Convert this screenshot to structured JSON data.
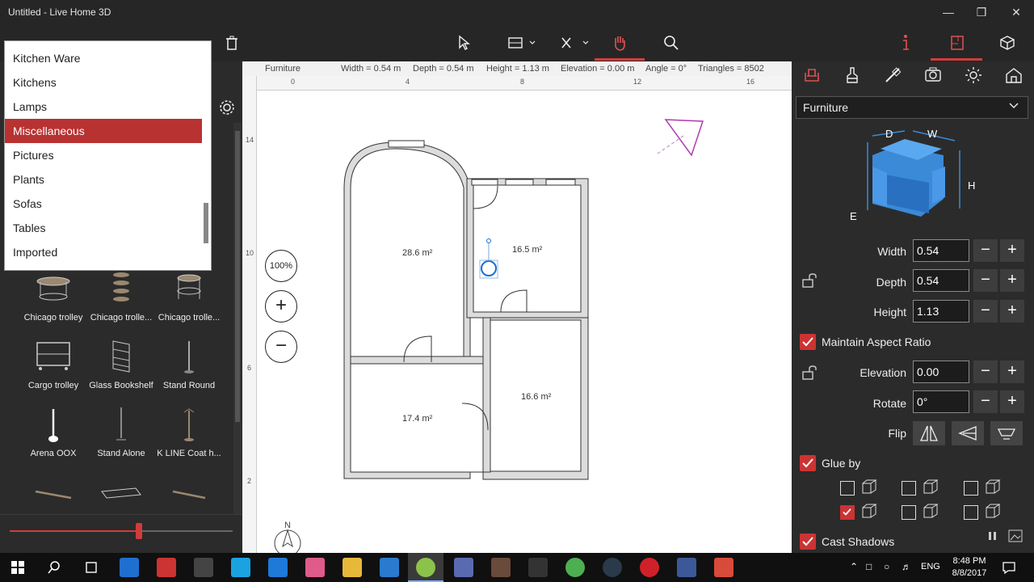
{
  "window": {
    "title": "Untitled - Live Home 3D"
  },
  "dropdown": {
    "items": [
      "Kitchen Ware",
      "Kitchens",
      "Lamps",
      "Miscellaneous",
      "Pictures",
      "Plants",
      "Sofas",
      "Tables",
      "Imported"
    ],
    "selected": "Miscellaneous"
  },
  "library": {
    "items": [
      "Chicago trolley",
      "Chicago trolle...",
      "Chicago trolle...",
      "Cargo trolley",
      "Glass Bookshelf",
      "Stand Round",
      "Arena OOX",
      "Stand Alone",
      "K LINE Coat h..."
    ]
  },
  "infobar": {
    "type": "Furniture",
    "width": "Width = 0.54 m",
    "depth": "Depth = 0.54 m",
    "height": "Height = 1.13 m",
    "elevation": "Elevation = 0.00 m",
    "angle": "Angle = 0°",
    "triangles": "Triangles = 8502"
  },
  "ruler": {
    "unit": "m",
    "h_ticks": [
      "0",
      "4",
      "8",
      "12",
      "16"
    ],
    "v_ticks": [
      "14",
      "10",
      "6",
      "2"
    ]
  },
  "plan": {
    "rooms": [
      "28.6 m²",
      "16.5 m²",
      "17.4 m²",
      "16.6 m²"
    ],
    "compass": "N"
  },
  "zoom": {
    "level": "100%",
    "in": "+",
    "out": "−"
  },
  "slider": {
    "value": 0.58
  },
  "right": {
    "category": "Furniture",
    "dims": {
      "d": "D",
      "w": "W",
      "h": "H",
      "e": "E"
    },
    "width_label": "Width",
    "width_value": "0.54",
    "depth_label": "Depth",
    "depth_value": "0.54",
    "height_label": "Height",
    "height_value": "1.13",
    "maintain_label": "Maintain Aspect Ratio",
    "elevation_label": "Elevation",
    "elevation_value": "0.00",
    "rotate_label": "Rotate",
    "rotate_value": "0°",
    "flip_label": "Flip",
    "glue_label": "Glue by",
    "shadows_label": "Cast Shadows",
    "minus": "−",
    "plus": "+"
  },
  "taskbar": {
    "lang": "ENG",
    "time": "8:48 PM",
    "date": "8/8/2017"
  },
  "colors": {
    "accent": "#d23b3b",
    "panel": "#2b2b2b",
    "selection": "#b83232"
  }
}
